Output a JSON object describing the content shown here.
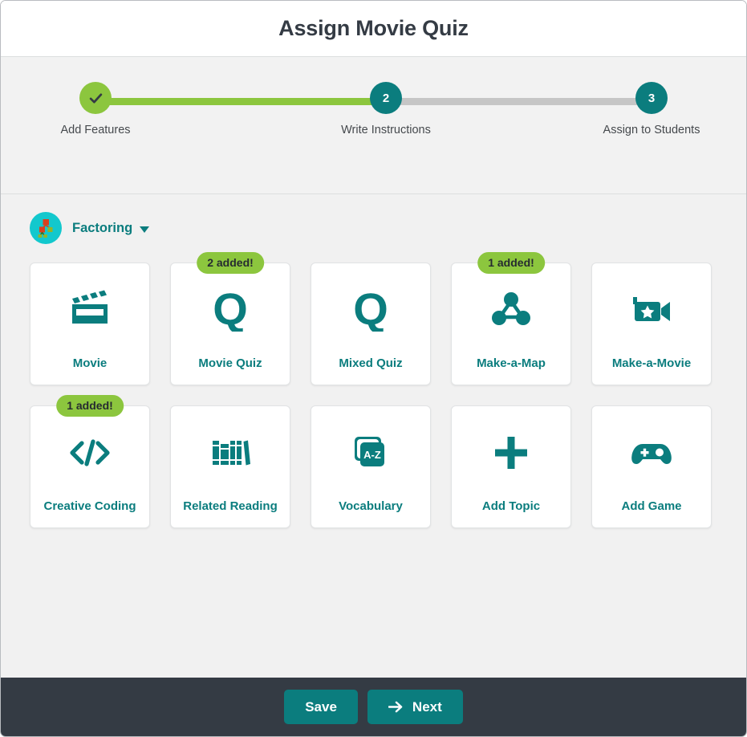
{
  "header": {
    "title": "Assign Movie Quiz"
  },
  "colors": {
    "teal": "#0b7d7e",
    "green": "#8cc63e",
    "cyan": "#12c8cd",
    "footer_dark": "#343b44",
    "body_gray": "#f1f1f1",
    "track_gray": "#c6c6c6"
  },
  "stepper": {
    "steps": [
      {
        "marker": "✓",
        "label": "Add Features",
        "state": "done"
      },
      {
        "marker": "2",
        "label": "Write Instructions",
        "state": "active"
      },
      {
        "marker": "3",
        "label": "Assign to Students",
        "state": "todo"
      }
    ]
  },
  "topic": {
    "name": "Factoring",
    "avatar_icon": "factor-tree-icon",
    "caret_icon": "chevron-down-icon"
  },
  "cards": [
    {
      "label": "Movie",
      "icon": "clapperboard-icon",
      "badge": null
    },
    {
      "label": "Movie Quiz",
      "icon": "letter-q-icon",
      "badge": "2 added!"
    },
    {
      "label": "Mixed Quiz",
      "icon": "letter-q-icon",
      "badge": null
    },
    {
      "label": "Make-a-Map",
      "icon": "node-graph-icon",
      "badge": "1 added!"
    },
    {
      "label": "Make-a-Movie",
      "icon": "video-camera-star-icon",
      "badge": null
    },
    {
      "label": "Creative Coding",
      "icon": "code-brackets-icon",
      "badge": "1 added!"
    },
    {
      "label": "Related Reading",
      "icon": "books-icon",
      "badge": null
    },
    {
      "label": "Vocabulary",
      "icon": "az-cards-icon",
      "badge": null
    },
    {
      "label": "Add Topic",
      "icon": "plus-icon",
      "badge": null
    },
    {
      "label": "Add Game",
      "icon": "gamepad-icon",
      "badge": null
    }
  ],
  "footer": {
    "save_label": "Save",
    "next_label": "Next",
    "next_icon": "arrow-right-icon"
  }
}
